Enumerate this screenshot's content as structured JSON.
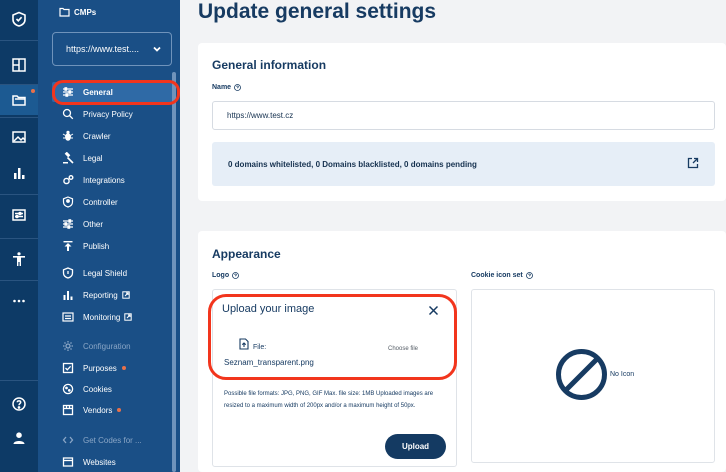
{
  "app": {
    "logo_icon": "shield-check-logo-icon"
  },
  "rail": {
    "items": [
      {
        "name": "logo",
        "icon": "shield-check-icon"
      },
      {
        "name": "dashboard",
        "icon": "layout-grid-icon"
      },
      {
        "name": "cmps",
        "icon": "folder-icon",
        "active": true,
        "has_dot": true
      },
      {
        "name": "images",
        "icon": "image-icon"
      },
      {
        "name": "reports",
        "icon": "bar-chart-icon"
      },
      {
        "name": "settings",
        "icon": "sliders-icon"
      },
      {
        "name": "accessibility",
        "icon": "accessibility-icon"
      },
      {
        "name": "more",
        "icon": "more-horizontal-icon"
      },
      {
        "name": "help",
        "icon": "help-circle-icon"
      },
      {
        "name": "account",
        "icon": "user-icon"
      }
    ],
    "dot_color": "#e8714a"
  },
  "sidebar": {
    "section_title": "CMPs",
    "site_select_value": "https://www.test....",
    "items": [
      {
        "label": "General",
        "icon": "sliders-icon",
        "active": true
      },
      {
        "label": "Privacy Policy",
        "icon": "privacy-icon"
      },
      {
        "label": "Crawler",
        "icon": "bug-icon"
      },
      {
        "label": "Legal",
        "icon": "gavel-icon"
      },
      {
        "label": "Integrations",
        "icon": "gears-icon"
      },
      {
        "label": "Controller",
        "icon": "shield-user-icon"
      },
      {
        "label": "Other",
        "icon": "sliders-icon"
      },
      {
        "label": "Publish",
        "icon": "publish-icon"
      },
      {
        "label": "Legal Shield",
        "icon": "shield-icon"
      },
      {
        "label": "Reporting",
        "icon": "bar-chart-icon",
        "external": true
      },
      {
        "label": "Monitoring",
        "icon": "monitoring-icon",
        "external": true
      },
      {
        "label": "Configuration",
        "icon": "gear-icon",
        "muted": true
      },
      {
        "label": "Purposes",
        "icon": "checkbox-icon",
        "has_dot": true
      },
      {
        "label": "Cookies",
        "icon": "cookie-icon"
      },
      {
        "label": "Vendors",
        "icon": "store-icon",
        "has_dot": true
      },
      {
        "label": "Get Codes for ...",
        "icon": "code-icon",
        "muted": true
      },
      {
        "label": "Websites",
        "icon": "window-icon"
      }
    ]
  },
  "main": {
    "title": "Update general settings",
    "general_information": {
      "heading": "General information",
      "name_label": "Name",
      "name_value": "https://www.test.cz",
      "domains_summary": "0 domains whitelisted, 0 Domains blacklisted, 0 domains pending",
      "open_icon": "external-link-icon"
    },
    "appearance": {
      "heading": "Appearance",
      "logo_label": "Logo",
      "cookie_icon_set_label": "Cookie icon set",
      "upload": {
        "title": "Upload your image",
        "file_label": "File:",
        "file_name": "Seznam_transparent.png",
        "choose_file": "Choose file",
        "formats": "Possible file formats: JPG, PNG, GIF Max. file size: 1MB Uploaded images are resized to a maximum width of 200px and/or a maximum height of 50px.",
        "button": "Upload"
      },
      "no_icon_label": "No Icon"
    }
  },
  "colors": {
    "rail_bg": "#0d3a66",
    "sidebar_bg": "#1a4f86",
    "accent": "#143a62",
    "highlight": "#f2351d"
  }
}
